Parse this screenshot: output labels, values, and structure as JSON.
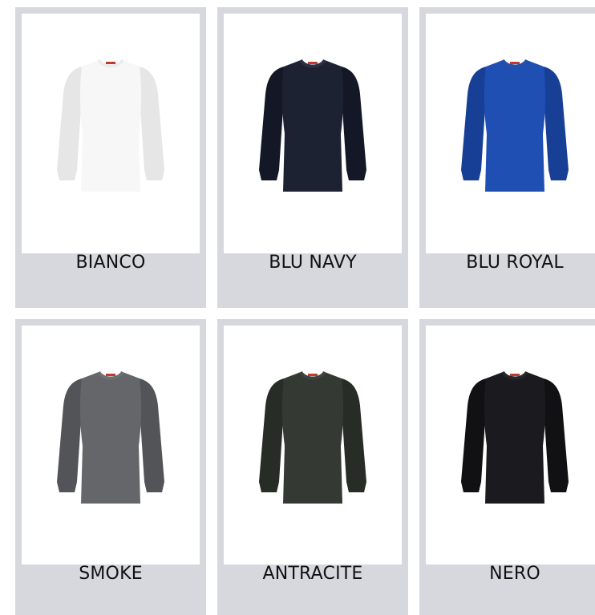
{
  "colors": [
    {
      "label": "BIANCO",
      "fill": "#f7f7f7",
      "shade": "#e6e6e6",
      "collar": "#ececec"
    },
    {
      "label": "BLU NAVY",
      "fill": "#1d2233",
      "shade": "#141826",
      "collar": "#2a2f44"
    },
    {
      "label": "BLU ROYAL",
      "fill": "#1f4fb3",
      "shade": "#173f95",
      "collar": "#264fa6"
    },
    {
      "label": "SMOKE",
      "fill": "#646669",
      "shade": "#525457",
      "collar": "#6e6f72"
    },
    {
      "label": "ANTRACITE",
      "fill": "#343a33",
      "shade": "#272c27",
      "collar": "#3d433c"
    },
    {
      "label": "NERO",
      "fill": "#1b1b1f",
      "shade": "#111114",
      "collar": "#26262a"
    }
  ]
}
